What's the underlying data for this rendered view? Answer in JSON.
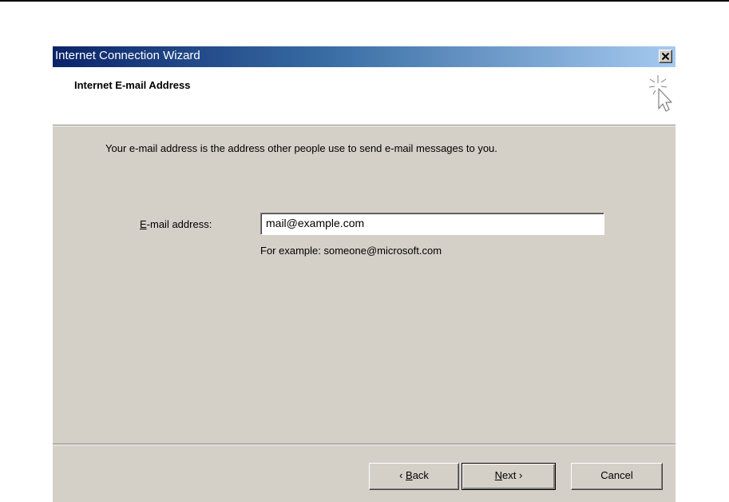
{
  "window": {
    "title": "Internet Connection Wizard"
  },
  "header": {
    "title": "Internet E-mail Address",
    "icon": "wizard-cursor-icon"
  },
  "main": {
    "intro": "Your e-mail address is the address other people use to send e-mail messages to you.",
    "email_label_mnemonic": "E",
    "email_label_rest": "-mail address:",
    "email_value": "mail@example.com",
    "example": "For example: someone@microsoft.com"
  },
  "buttons": {
    "back_arrow": "‹",
    "back_mnemonic": "B",
    "back_rest": "ack",
    "next_mnemonic": "N",
    "next_rest": "ext",
    "next_arrow": "›",
    "cancel": "Cancel"
  },
  "colors": {
    "title_bar_start": "#0a246a",
    "title_bar_end": "#a6caf0",
    "dialog_face": "#d4d0c8"
  }
}
